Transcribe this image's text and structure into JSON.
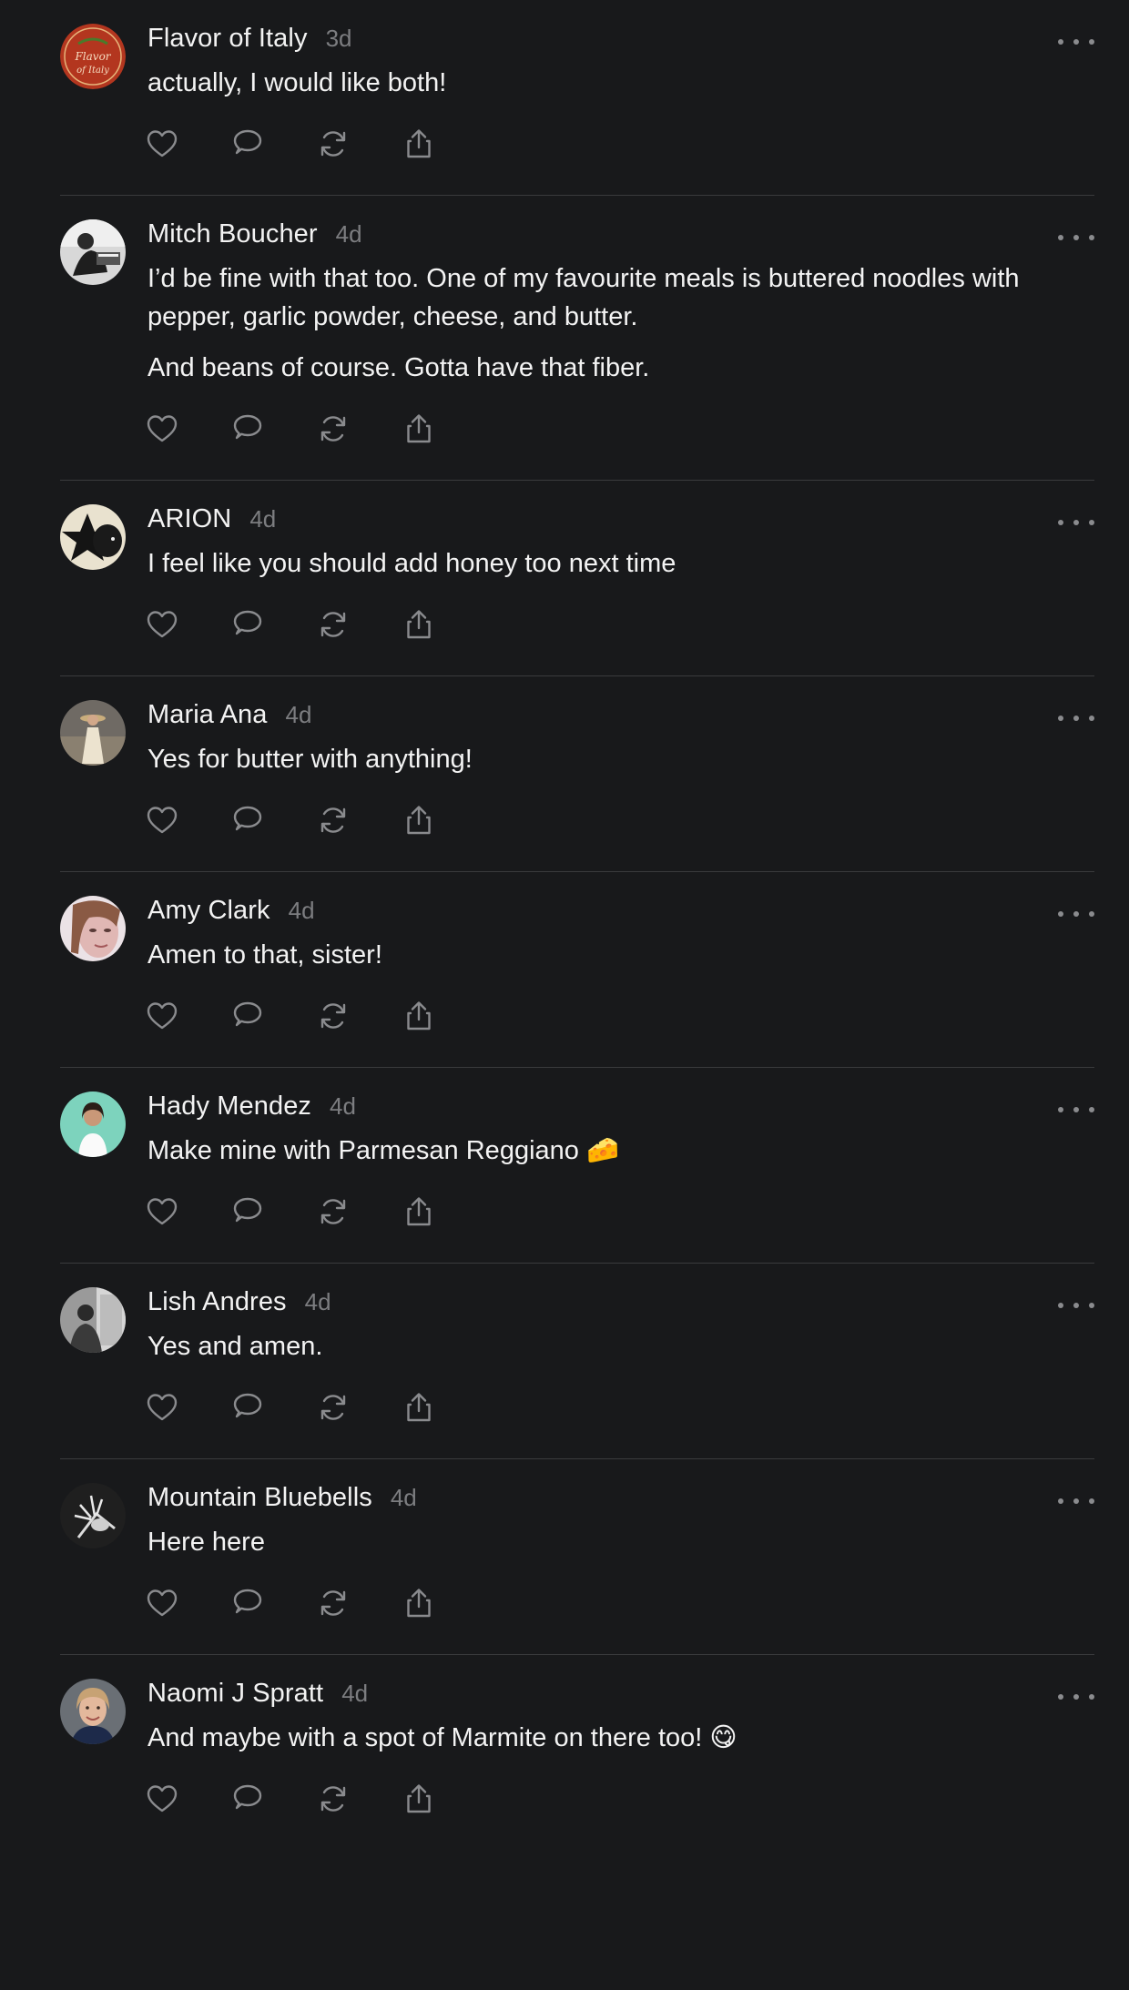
{
  "posts": [
    {
      "name": "Flavor of Italy",
      "time": "3d",
      "paragraphs": [
        "actually, I would like both!"
      ],
      "avatar": "flavor-of-italy-avatar"
    },
    {
      "name": "Mitch Boucher",
      "time": "4d",
      "paragraphs": [
        "I’d be fine with that too. One of my favourite meals is buttered noodles with pepper, garlic powder, cheese, and butter.",
        "And beans of course. Gotta have that fiber."
      ],
      "avatar": "mitch-boucher-avatar"
    },
    {
      "name": "ARION",
      "time": "4d",
      "paragraphs": [
        "I feel like you should add honey too next time"
      ],
      "avatar": "arion-avatar"
    },
    {
      "name": "Maria Ana",
      "time": "4d",
      "paragraphs": [
        "Yes for butter with anything!"
      ],
      "avatar": "maria-ana-avatar"
    },
    {
      "name": "Amy Clark",
      "time": "4d",
      "paragraphs": [
        "Amen to that, sister!"
      ],
      "avatar": "amy-clark-avatar"
    },
    {
      "name": "Hady Mendez",
      "time": "4d",
      "paragraphs": [
        "Make mine with Parmesan Reggiano 🧀"
      ],
      "avatar": "hady-mendez-avatar"
    },
    {
      "name": "Lish Andres",
      "time": "4d",
      "paragraphs": [
        "Yes and amen."
      ],
      "avatar": "lish-andres-avatar"
    },
    {
      "name": "Mountain Bluebells",
      "time": "4d",
      "paragraphs": [
        "Here here"
      ],
      "avatar": "mountain-bluebells-avatar"
    },
    {
      "name": "Naomi J Spratt",
      "time": "4d",
      "paragraphs": [
        "And maybe with a spot of Marmite on there too! 😋"
      ],
      "avatar": "naomi-j-spratt-avatar"
    }
  ],
  "colors": {
    "background": "#18191b",
    "divider": "#3a3b3d",
    "text": "#f3f3f3",
    "muted": "#7c7d80",
    "icon": "#8a8b8e"
  },
  "icons": [
    "heart-icon",
    "comment-icon",
    "repost-icon",
    "share-icon",
    "more-icon"
  ]
}
